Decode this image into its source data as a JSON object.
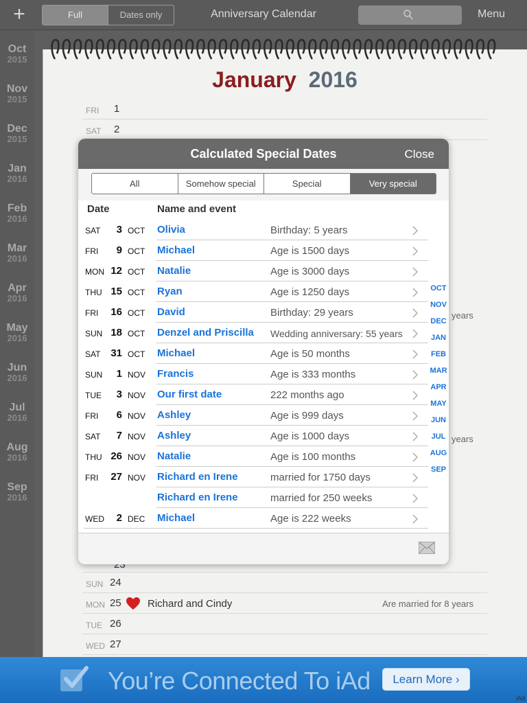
{
  "toolbar": {
    "add_icon": "plus-icon",
    "view_options": [
      "Full",
      "Dates only"
    ],
    "selected_view": "Full",
    "title": "Anniversary Calendar",
    "search_icon": "magnifier-icon",
    "menu_label": "Menu"
  },
  "sidebar": {
    "items": [
      {
        "month": "Oct",
        "year": "2015"
      },
      {
        "month": "Nov",
        "year": "2015"
      },
      {
        "month": "Dec",
        "year": "2015"
      },
      {
        "month": "Jan",
        "year": "2016"
      },
      {
        "month": "Feb",
        "year": "2016"
      },
      {
        "month": "Mar",
        "year": "2016"
      },
      {
        "month": "Apr",
        "year": "2016"
      },
      {
        "month": "May",
        "year": "2016"
      },
      {
        "month": "Jun",
        "year": "2016"
      },
      {
        "month": "Jul",
        "year": "2016"
      },
      {
        "month": "Aug",
        "year": "2016"
      },
      {
        "month": "Sep",
        "year": "2016"
      }
    ]
  },
  "calendar": {
    "month": "January",
    "year": "2016",
    "top_rows": [
      {
        "weekday": "FRI",
        "day": "1"
      },
      {
        "weekday": "SAT",
        "day": "2"
      }
    ],
    "peek_text": [
      "years",
      "years"
    ],
    "partial_day": "23",
    "bottom_rows": [
      {
        "weekday": "SUN",
        "day": "24",
        "name": "",
        "event": ""
      },
      {
        "weekday": "MON",
        "day": "25",
        "name": "Richard and Cindy",
        "event": "Are married for 8 years"
      },
      {
        "weekday": "TUE",
        "day": "26",
        "name": "",
        "event": ""
      },
      {
        "weekday": "WED",
        "day": "27",
        "name": "",
        "event": ""
      }
    ]
  },
  "modal": {
    "title": "Calculated Special Dates",
    "close_label": "Close",
    "filters": [
      "All",
      "Somehow special",
      "Special",
      "Very special"
    ],
    "selected_filter": "Very special",
    "col_date": "Date",
    "col_name": "Name and event",
    "rows": [
      {
        "weekday": "SAT",
        "day": "3",
        "month": "OCT",
        "name": "Olivia",
        "event": "Birthday: 5 years"
      },
      {
        "weekday": "FRI",
        "day": "9",
        "month": "OCT",
        "name": "Michael",
        "event": "Age is 1500 days"
      },
      {
        "weekday": "MON",
        "day": "12",
        "month": "OCT",
        "name": "Natalie",
        "event": "Age is 3000 days"
      },
      {
        "weekday": "THU",
        "day": "15",
        "month": "OCT",
        "name": "Ryan",
        "event": "Age is 1250 days"
      },
      {
        "weekday": "FRI",
        "day": "16",
        "month": "OCT",
        "name": "David",
        "event": "Birthday: 29 years"
      },
      {
        "weekday": "SUN",
        "day": "18",
        "month": "OCT",
        "name": "Denzel and Priscilla",
        "event": "Wedding anniversary: 55 years"
      },
      {
        "weekday": "SAT",
        "day": "31",
        "month": "OCT",
        "name": "Michael",
        "event": "Age is 50 months"
      },
      {
        "weekday": "SUN",
        "day": "1",
        "month": "NOV",
        "name": "Francis",
        "event": "Age is 333 months"
      },
      {
        "weekday": "TUE",
        "day": "3",
        "month": "NOV",
        "name": "Our first date",
        "event": "222 months ago"
      },
      {
        "weekday": "FRI",
        "day": "6",
        "month": "NOV",
        "name": "Ashley",
        "event": "Age is 999 days"
      },
      {
        "weekday": "SAT",
        "day": "7",
        "month": "NOV",
        "name": "Ashley",
        "event": "Age is 1000 days"
      },
      {
        "weekday": "THU",
        "day": "26",
        "month": "NOV",
        "name": "Natalie",
        "event": "Age is 100 months"
      },
      {
        "weekday": "FRI",
        "day": "27",
        "month": "NOV",
        "name": "Richard en Irene",
        "event": "married for 1750 days"
      },
      {
        "weekday": "",
        "day": "",
        "month": "",
        "name": "Richard en Irene",
        "event": "married for 250 weeks"
      },
      {
        "weekday": "WED",
        "day": "2",
        "month": "DEC",
        "name": "Michael",
        "event": "Age is 222 weeks"
      }
    ],
    "month_index": [
      "OCT",
      "NOV",
      "DEC",
      "JAN",
      "FEB",
      "MAR",
      "APR",
      "MAY",
      "JUN",
      "JUL",
      "AUG",
      "SEP"
    ],
    "mail_icon": "envelope-icon"
  },
  "ad": {
    "text": "You’re Connected To iAd",
    "button": "Learn More",
    "label": "iAd"
  },
  "colors": {
    "accent_blue": "#1a73d9",
    "month_red": "#8a1e1e",
    "year_slate": "#5b6a78",
    "toolbar_gray": "#5a5a5a"
  }
}
